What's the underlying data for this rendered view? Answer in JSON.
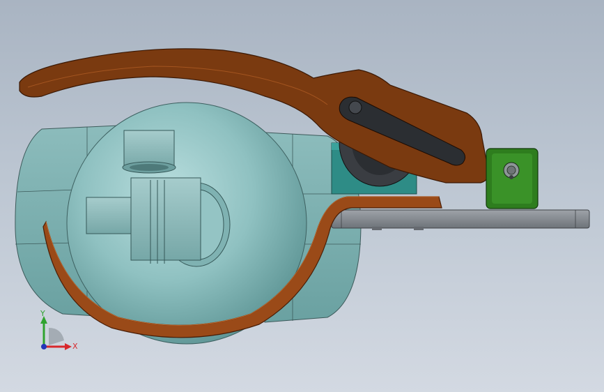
{
  "triad": {
    "x_label": "X",
    "y_label": "Y",
    "x_color": "#d8282c",
    "y_color": "#2fa32f",
    "z_color": "#2436b8"
  },
  "model": {
    "handle_color": "#7a3a10",
    "bracket_color": "#9a4a18",
    "body_color": "#8fc1c1",
    "base_plate_color": "#8a8e94",
    "teal_block_color": "#2e8c86",
    "pivot_block_color": "#2e7d1e"
  }
}
